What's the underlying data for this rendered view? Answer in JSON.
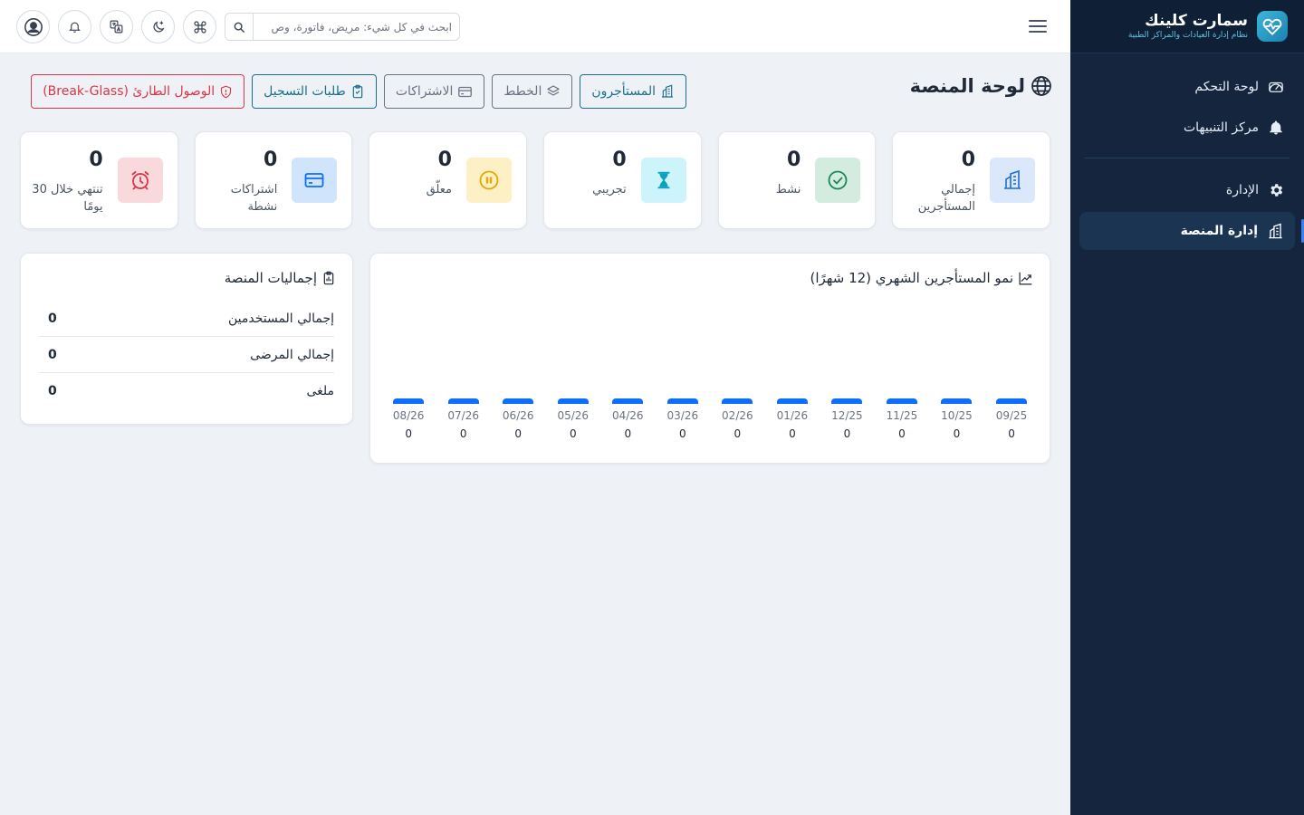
{
  "brand": {
    "name": "سمارت كلينك",
    "subtitle": "نظام إدارة العيادات والمراكز الطبية"
  },
  "sidebar": {
    "items": [
      {
        "label": "لوحة التحكم",
        "icon": "dashboard-gauge-icon"
      },
      {
        "label": "مركز التنبيهات",
        "icon": "bell-icon"
      },
      {
        "label": "الإدارة",
        "icon": "gear-icon"
      },
      {
        "label": "إدارة المنصة",
        "icon": "buildings-icon",
        "active": true
      }
    ]
  },
  "topbar": {
    "search_placeholder": "ابحث في كل شيء: مريض، فاتورة، وص",
    "icons": [
      "search-icon",
      "command-icon",
      "moon-icon",
      "translate-icon",
      "bell-icon",
      "user-circle-icon"
    ]
  },
  "page": {
    "title": "لوحة المنصة",
    "actions": [
      {
        "label": "المستأجرون",
        "icon": "buildings-icon",
        "style": "teal"
      },
      {
        "label": "الخطط",
        "icon": "layers-icon",
        "style": "gray"
      },
      {
        "label": "الاشتراكات",
        "icon": "credit-card-icon",
        "style": "gray"
      },
      {
        "label": "طلبات التسجيل",
        "icon": "clipboard-check-icon",
        "style": "teal"
      },
      {
        "label": "الوصول الطارئ (Break-Glass)",
        "icon": "shield-icon",
        "style": "red"
      }
    ]
  },
  "stats": [
    {
      "value": "0",
      "label": "إجمالي المستأجرين",
      "icon": "buildings-icon",
      "bg": "#dbe7fb",
      "fg": "#1d6fd6"
    },
    {
      "value": "0",
      "label": "نشط",
      "icon": "check-circle-icon",
      "bg": "#d4ece0",
      "fg": "#198754"
    },
    {
      "value": "0",
      "label": "تجريبي",
      "icon": "hourglass-icon",
      "bg": "#cdf3fb",
      "fg": "#0aa2c0"
    },
    {
      "value": "0",
      "label": "معلّق",
      "icon": "pause-circle-icon",
      "bg": "#fdf0c4",
      "fg": "#e0a800"
    },
    {
      "value": "0",
      "label": "اشتراكات نشطة",
      "icon": "credit-card-icon",
      "bg": "#d0e4fb",
      "fg": "#0d6efd"
    },
    {
      "value": "0",
      "label": "تنتهي خلال 30 يومًا",
      "icon": "alarm-icon",
      "bg": "#f8d9dc",
      "fg": "#dc3545"
    }
  ],
  "growth": {
    "title": "نمو المستأجرين الشهري (12 شهرًا)"
  },
  "chart_data": {
    "type": "bar",
    "title": "نمو المستأجرين الشهري (12 شهرًا)",
    "categories": [
      "09/25",
      "10/25",
      "11/25",
      "12/25",
      "01/26",
      "02/26",
      "03/26",
      "04/26",
      "05/26",
      "06/26",
      "07/26",
      "08/26"
    ],
    "values": [
      0,
      0,
      0,
      0,
      0,
      0,
      0,
      0,
      0,
      0,
      0,
      0
    ],
    "color": "#0d6efd"
  },
  "totals": {
    "title": "إجماليات المنصة",
    "rows": [
      {
        "label": "إجمالي المستخدمين",
        "value": "0"
      },
      {
        "label": "إجمالي المرضى",
        "value": "0"
      },
      {
        "label": "ملغى",
        "value": "0"
      }
    ]
  }
}
